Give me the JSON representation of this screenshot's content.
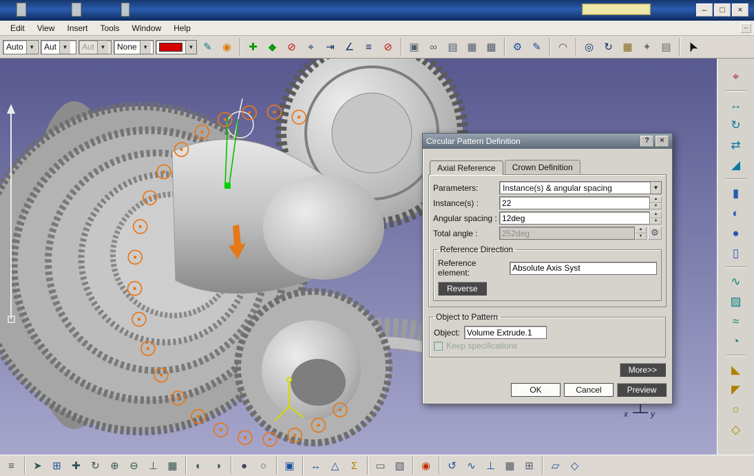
{
  "titlebar": {
    "buttons": {
      "min": "–",
      "max": "□",
      "close": "×"
    }
  },
  "menubar": {
    "items": [
      "Edit",
      "View",
      "Insert",
      "Tools",
      "Window",
      "Help"
    ],
    "overflow": "–"
  },
  "ui": {
    "combo_arrow": "▼",
    "spin_up": "▲",
    "spin_down": "▼",
    "formula_glyph": "⚙",
    "help_glyph": "?",
    "close_glyph": "×"
  },
  "toolbars": {
    "top": {
      "combos": [
        {
          "value": "Auto"
        },
        {
          "value": "Aut"
        },
        {
          "value": "Aut"
        },
        {
          "value": "None"
        }
      ],
      "swatch_color": "#d40000",
      "icons": [
        {
          "name": "graphic-properties-icon",
          "glyph": "✎",
          "color": "#0a7a7a"
        },
        {
          "name": "painter-icon",
          "glyph": "◉",
          "color": "#d97c00"
        },
        {
          "sep": true
        },
        {
          "name": "pan-compass-icon",
          "glyph": "✚",
          "color": "#0a9a0a"
        },
        {
          "name": "rotate-compass-icon",
          "glyph": "◆",
          "color": "#0a9a0a"
        },
        {
          "name": "no-compass-icon",
          "glyph": "⊘",
          "color": "#c01010"
        },
        {
          "name": "snap-point-icon",
          "glyph": "⌖",
          "color": "#103070"
        },
        {
          "name": "snap-line-icon",
          "glyph": "⇥",
          "color": "#103070"
        },
        {
          "name": "snap-angle-icon",
          "glyph": "∠",
          "color": "#103070"
        },
        {
          "name": "measure-list-icon",
          "glyph": "≡",
          "color": "#103070"
        },
        {
          "name": "no-snap-icon",
          "glyph": "⊘",
          "color": "#c01010"
        },
        {
          "sep": true
        },
        {
          "name": "paste-format-icon",
          "glyph": "▣",
          "color": "#556070"
        },
        {
          "name": "link-window-icon",
          "glyph": "∞",
          "color": "#556070"
        },
        {
          "name": "copy-view-icon",
          "glyph": "▤",
          "color": "#556070"
        },
        {
          "name": "datum-grid-icon",
          "glyph": "▦",
          "color": "#556070"
        },
        {
          "name": "chain-select-icon",
          "glyph": "▩",
          "color": "#556070"
        },
        {
          "sep": true
        },
        {
          "name": "knowledge-gear-icon",
          "glyph": "⚙",
          "color": "#1c4fa0"
        },
        {
          "name": "formula-edit-icon",
          "glyph": "✎",
          "color": "#1c4fa0"
        },
        {
          "sep": true
        },
        {
          "name": "arc-tool-icon",
          "glyph": "◠",
          "color": "#555555"
        },
        {
          "sep": true
        },
        {
          "name": "zoom-area-icon",
          "glyph": "◎",
          "color": "#103070"
        },
        {
          "name": "rotate-view-icon",
          "glyph": "↻",
          "color": "#103070"
        },
        {
          "name": "named-views-icon",
          "glyph": "▦",
          "color": "#8a6a20"
        },
        {
          "name": "render-style-icon",
          "glyph": "✦",
          "color": "#6a6a6a"
        },
        {
          "name": "catalog-icon",
          "glyph": "▤",
          "color": "#6a6a6a"
        },
        {
          "sep": true
        },
        {
          "name": "select-cursor-icon",
          "glyph": "➤",
          "color": "#111111",
          "size": 19,
          "rot": -115
        }
      ]
    },
    "right": {
      "icons": [
        {
          "name": "axis-system-icon",
          "glyph": "⌖",
          "color": "#b03060"
        },
        {
          "sep": true
        },
        {
          "name": "translate-icon",
          "glyph": "↔",
          "color": "#0a7aa0"
        },
        {
          "name": "rotate-feature-icon",
          "glyph": "↻",
          "color": "#0a7aa0"
        },
        {
          "name": "symmetry-icon",
          "glyph": "⇄",
          "color": "#0a7aa0"
        },
        {
          "name": "scale-icon",
          "glyph": "◢",
          "color": "#0a7aa0"
        },
        {
          "sep": true
        },
        {
          "name": "extrude-icon",
          "glyph": "▮",
          "color": "#2a5ab0"
        },
        {
          "name": "revolve-icon",
          "glyph": "◐",
          "color": "#2a5ab0"
        },
        {
          "name": "sphere-icon",
          "glyph": "●",
          "color": "#2a5ab0"
        },
        {
          "name": "cylinder-icon",
          "glyph": "▯",
          "color": "#2a5ab0"
        },
        {
          "sep": true
        },
        {
          "name": "sweep-icon",
          "glyph": "∿",
          "color": "#108080"
        },
        {
          "name": "fill-surface-icon",
          "glyph": "▨",
          "color": "#108080"
        },
        {
          "name": "multi-sections-icon",
          "glyph": "≈",
          "color": "#108080"
        },
        {
          "name": "blend-icon",
          "glyph": "◔",
          "color": "#108080"
        },
        {
          "sep": true
        },
        {
          "name": "split-icon",
          "glyph": "◣",
          "color": "#b08000"
        },
        {
          "name": "trim-icon",
          "glyph": "◤",
          "color": "#b08000"
        },
        {
          "name": "boundary-icon",
          "glyph": "○",
          "color": "#b08000"
        },
        {
          "name": "extract-icon",
          "glyph": "◇",
          "color": "#b08000"
        }
      ]
    },
    "bottom": {
      "icons": [
        {
          "name": "tree-expand-icon",
          "glyph": "≡",
          "color": "#555555"
        },
        {
          "sep": true
        },
        {
          "name": "fly-mode-icon",
          "glyph": "➤",
          "color": "#335555"
        },
        {
          "name": "fit-all-in-icon",
          "glyph": "⊞",
          "color": "#1c4fa0"
        },
        {
          "name": "pan-icon",
          "glyph": "✚",
          "color": "#335555"
        },
        {
          "name": "rotate-3d-icon",
          "glyph": "↻",
          "color": "#335555"
        },
        {
          "name": "zoom-in-icon",
          "glyph": "⊕",
          "color": "#335555"
        },
        {
          "name": "zoom-out-icon",
          "glyph": "⊖",
          "color": "#335555"
        },
        {
          "name": "normal-view-icon",
          "glyph": "⊥",
          "color": "#335555"
        },
        {
          "name": "multi-view-icon",
          "glyph": "▦",
          "color": "#335555"
        },
        {
          "sep": true
        },
        {
          "name": "quick-hide-show-icon",
          "glyph": "◐",
          "color": "#335555"
        },
        {
          "name": "hide-show-icon",
          "glyph": "◑",
          "color": "#335555"
        },
        {
          "sep": true
        },
        {
          "name": "shading-icon",
          "glyph": "●",
          "color": "#444466"
        },
        {
          "name": "wireframe-icon",
          "glyph": "○",
          "color": "#444466"
        },
        {
          "sep": true
        },
        {
          "name": "blue-grid-icon",
          "glyph": "▣",
          "color": "#1c4fa0"
        },
        {
          "sep": true
        },
        {
          "name": "measure-between-icon",
          "glyph": "↔",
          "color": "#1c4fa0"
        },
        {
          "name": "measure-item-icon",
          "glyph": "△",
          "color": "#1c4fa0"
        },
        {
          "name": "mass-properties-icon",
          "glyph": "Σ",
          "color": "#b08000"
        },
        {
          "sep": true
        },
        {
          "name": "wireframe-toggle-icon",
          "glyph": "▭",
          "color": "#555566"
        },
        {
          "name": "depth-effect-icon",
          "glyph": "▧",
          "color": "#555566"
        },
        {
          "sep": true
        },
        {
          "name": "power-input-icon",
          "glyph": "◉",
          "color": "#c03000"
        },
        {
          "sep": true
        },
        {
          "name": "spiral-icon",
          "glyph": "↺",
          "color": "#1c4fa0"
        },
        {
          "name": "helix-icon",
          "glyph": "∿",
          "color": "#1c4fa0"
        },
        {
          "name": "axis-line-icon",
          "glyph": "⊥",
          "color": "#1c4fa0"
        },
        {
          "name": "work-grid-icon",
          "glyph": "▦",
          "color": "#555566"
        },
        {
          "name": "snap-to-grid-icon",
          "glyph": "⊞",
          "color": "#555566"
        },
        {
          "sep": true
        },
        {
          "name": "plane-icon",
          "glyph": "▱",
          "color": "#1c4fa0"
        },
        {
          "name": "point-icon",
          "glyph": "◇",
          "color": "#1c4fa0"
        }
      ]
    }
  },
  "dialog": {
    "title": "Circular Pattern Definition",
    "tabs": [
      "Axial Reference",
      "Crown Definition"
    ],
    "parameters_label": "Parameters:",
    "parameters_value": "Instance(s) & angular spacing",
    "instances_label": "Instance(s) :",
    "instances_value": "22",
    "angular_label": "Angular spacing :",
    "angular_value": "12deg",
    "total_label": "Total angle :",
    "total_value": "252deg",
    "reference_group": "Reference Direction",
    "reference_label": "Reference element:",
    "reference_value": "Absolute Axis Syst",
    "reverse_label": "Reverse",
    "object_group": "Object to Pattern",
    "object_label": "Object:",
    "object_value": "Volume Extrude.1",
    "keep_spec_label": "Keep specifications",
    "more_label": "More>>",
    "ok_label": "OK",
    "cancel_label": "Cancel",
    "preview_label": "Preview"
  },
  "viewport": {
    "pattern_count": 22,
    "axis_x": "x",
    "axis_y": "y"
  }
}
